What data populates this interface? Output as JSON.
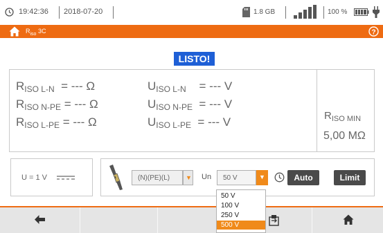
{
  "statusbar": {
    "time": "19:42:36",
    "date": "2018-07-20",
    "storage": "1.8 GB",
    "battery": "100 %"
  },
  "titlebar": {
    "title_main": "R",
    "title_sub": "iso",
    "title_suffix": " 3C"
  },
  "status_badge": "LISTO!",
  "results": {
    "r_lines": [
      {
        "main": "R",
        "sub": "ISO L-N",
        "value": "= --- Ω"
      },
      {
        "main": "R",
        "sub": "ISO N-PE",
        "value": "= --- Ω"
      },
      {
        "main": "R",
        "sub": "ISO L-PE",
        "value": "= --- Ω"
      }
    ],
    "u_lines": [
      {
        "main": "U",
        "sub": "ISO L-N",
        "value": "= --- V"
      },
      {
        "main": "U",
        "sub": "ISO N-PE",
        "value": "= --- V"
      },
      {
        "main": "U",
        "sub": "ISO L-PE",
        "value": "= --- V"
      }
    ],
    "riso_min_label_main": "R",
    "riso_min_label_sub": "ISO MIN",
    "riso_min_value": "5,00 MΩ"
  },
  "params": {
    "voltage_label": "U = 1 V",
    "lead_select": "(N)(PE)(L)",
    "un_label": "Un",
    "un_value": "50 V",
    "auto_label": "Auto",
    "limit_label": "Limit",
    "un_options": [
      "50 V",
      "100 V",
      "250 V",
      "500 V"
    ],
    "un_selected_index": 3
  },
  "navbar": {
    "icons": [
      "back-arrow-icon",
      "save-memory-icon",
      "home-icon"
    ]
  }
}
